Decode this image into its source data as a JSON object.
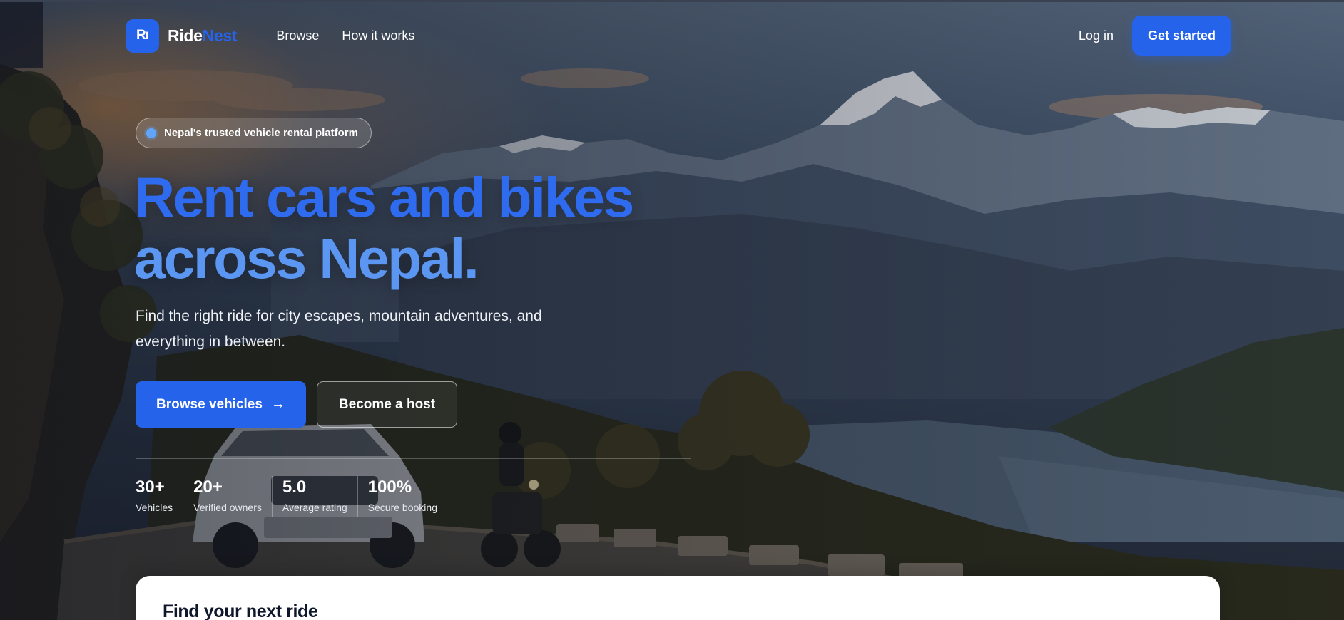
{
  "nav": {
    "logo_mark": "Rı",
    "brand_part1": "Ride",
    "brand_part2": "Nest",
    "links": [
      "Browse",
      "How it works"
    ],
    "login_label": "Log in",
    "cta_label": "Get started"
  },
  "hero": {
    "badge_text": "Nepal's trusted vehicle rental platform",
    "headline_line1": "Rent cars and bikes",
    "headline_line2": "across Nepal.",
    "subcopy": "Find the right ride for city escapes, mountain adventures, and everything in between.",
    "primary_button": "Browse vehicles",
    "primary_button_icon": "arrow-right-icon",
    "secondary_button": "Become a host",
    "stats": [
      {
        "value": "30+",
        "label": "Vehicles"
      },
      {
        "value": "20+",
        "label": "Verified owners"
      },
      {
        "value": "5.0",
        "label": "Average rating"
      },
      {
        "value": "100%",
        "label": "Secure booking"
      }
    ]
  },
  "search_card": {
    "title": "Find your next ride"
  },
  "colors": {
    "brand": "#2563eb",
    "headline_line1": "#2f6bef",
    "headline_line2": "#5b97f2",
    "badge_dot": "#60a5fa"
  }
}
